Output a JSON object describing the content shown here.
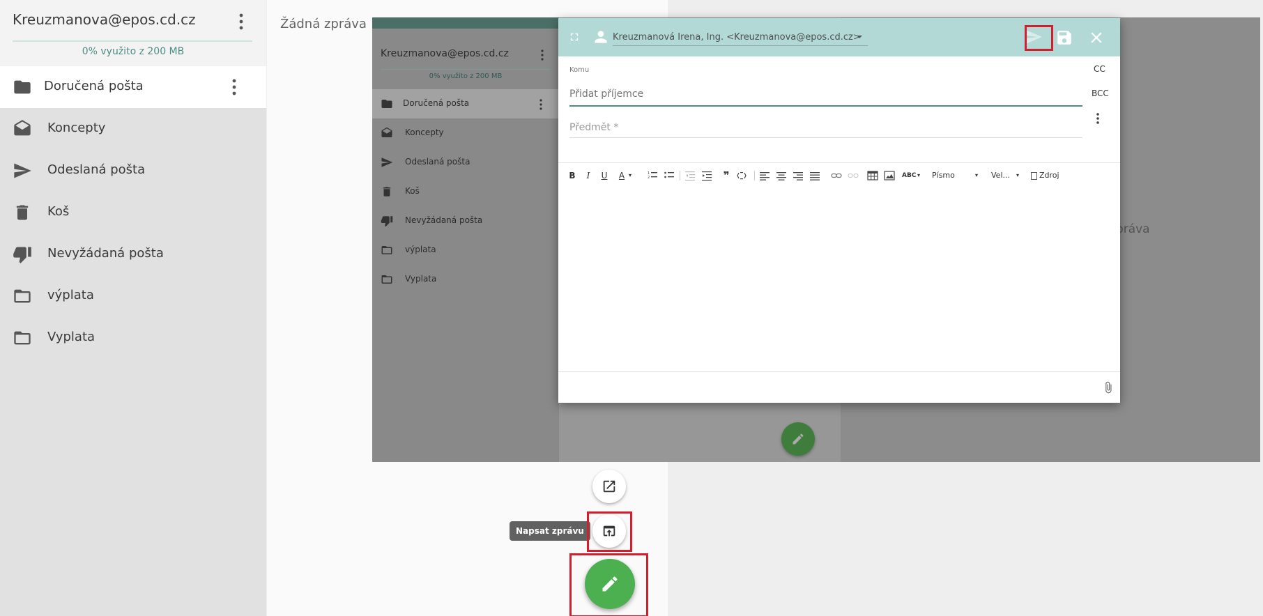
{
  "sidebar": {
    "account_email": "Kreuzmanova@epos.cd.cz",
    "usage": "0% využito z 200 MB",
    "folders": [
      {
        "label": "Doručená pošta",
        "icon": "folder-icon"
      },
      {
        "label": "Koncepty",
        "icon": "drafts-icon"
      },
      {
        "label": "Odeslaná pošta",
        "icon": "send-icon"
      },
      {
        "label": "Koš",
        "icon": "trash-icon"
      },
      {
        "label": "Nevyžádaná pošta",
        "icon": "thumb-down-icon"
      },
      {
        "label": "výplata",
        "icon": "folder-outline-icon"
      },
      {
        "label": "Vyplata",
        "icon": "folder-outline-icon"
      }
    ]
  },
  "main": {
    "no_message": "Žádná zpráva"
  },
  "overlay": {
    "account_email": "Kreuzmanova@epos.cd.cz",
    "usage": "0% využito z 200 MB",
    "folders": [
      "Doručená pošta",
      "Koncepty",
      "Odeslaná pošta",
      "Koš",
      "Nevyžádaná pošta",
      "výplata",
      "Vyplata"
    ],
    "no_message_fragment": "zpráva"
  },
  "compose": {
    "from": "Kreuzmanová Irena, Ing. <Kreuzmanova@epos.cd.cz>",
    "to_label": "Komu",
    "to_placeholder": "Přidat příjemce",
    "cc": "CC",
    "bcc": "BCC",
    "subject_placeholder": "Předmět *",
    "toolbar": {
      "bold": "B",
      "italic": "I",
      "underline": "U",
      "text_color": "A",
      "font": "Písmo",
      "size": "Vel...",
      "source": "Zdroj"
    }
  },
  "fab": {
    "tooltip": "Napsat zprávu"
  },
  "colors": {
    "accent": "#4caf50",
    "compose_header": "#b2d9d6",
    "highlight": "#d11f2f"
  }
}
